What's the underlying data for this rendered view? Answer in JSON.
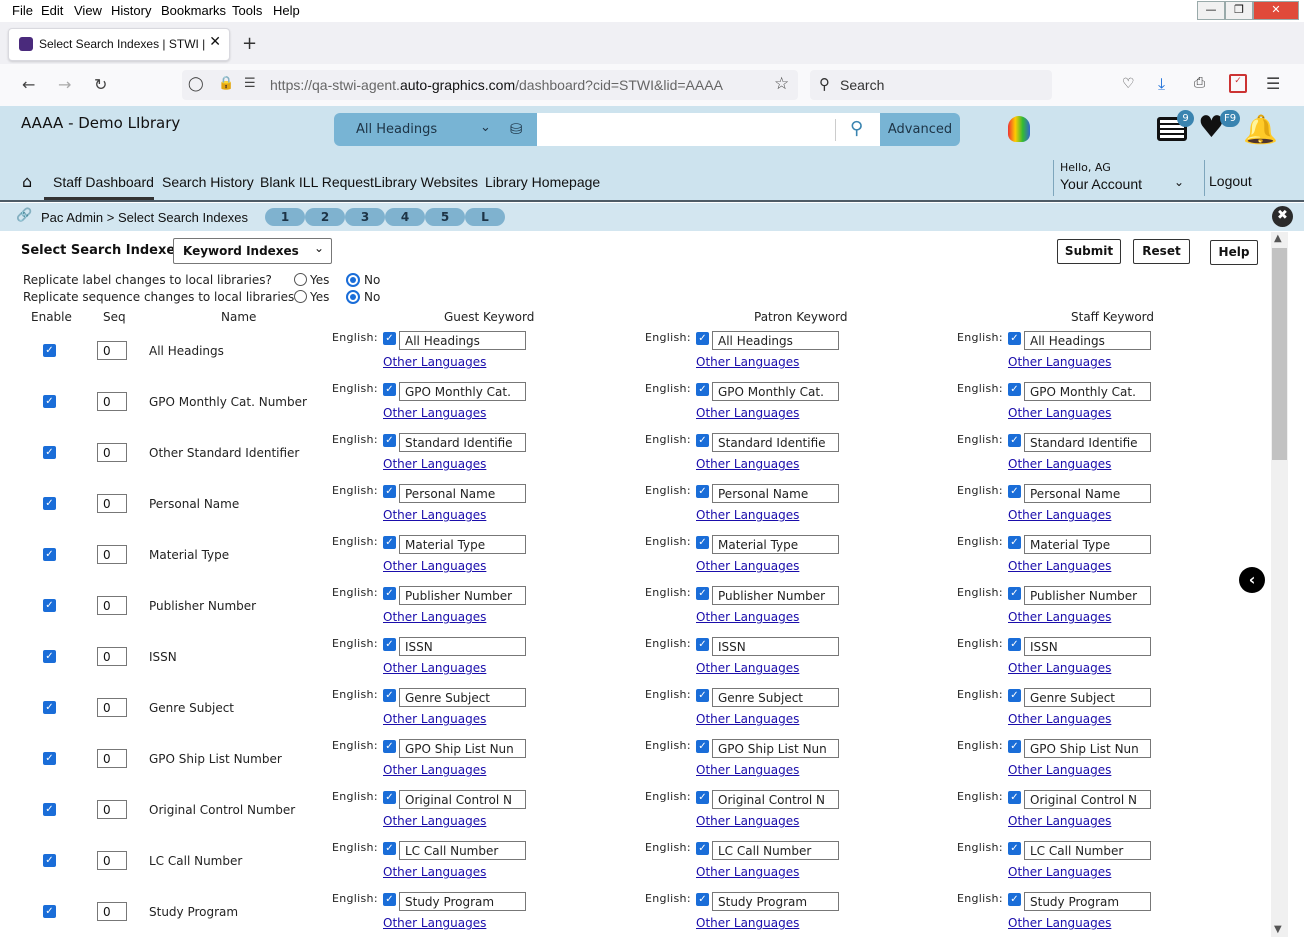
{
  "menubar": [
    "File",
    "Edit",
    "View",
    "History",
    "Bookmarks",
    "Tools",
    "Help"
  ],
  "browser": {
    "tab_title": "Select Search Indexes | STWI | aa",
    "url_prefix": "https://qa-stwi-agent.",
    "url_domain": "auto-graphics.com",
    "url_path": "/dashboard?cid=STWI&lid=AAAA",
    "search_placeholder": "Search"
  },
  "header": {
    "library_name": "AAAA - Demo LIbrary",
    "heading_select": "All Headings",
    "advanced_label": "Advanced",
    "list_badge": "9",
    "fav_badge": "F9"
  },
  "nav": {
    "items": [
      "Staff Dashboard",
      "Search History",
      "Blank ILL Request",
      "Library Websites",
      "Library Homepage"
    ],
    "greeting": "Hello, AG",
    "account": "Your Account",
    "logout": "Logout"
  },
  "breadcrumb": {
    "text": "Pac Admin > Select Search Indexes",
    "pills": [
      "1",
      "2",
      "3",
      "4",
      "5",
      "L"
    ]
  },
  "page": {
    "title": "Select Search Indexes",
    "index_type": "Keyword Indexes",
    "submit": "Submit",
    "reset": "Reset",
    "help": "Help",
    "q1": "Replicate label changes to local libraries?",
    "q2": "Replicate sequence changes to local libraries?",
    "yes": "Yes",
    "no": "No",
    "q1_value": "No",
    "q2_value": "No",
    "col_enable": "Enable",
    "col_seq": "Seq",
    "col_name": "Name",
    "col_guest": "Guest Keyword",
    "col_patron": "Patron Keyword",
    "col_staff": "Staff Keyword",
    "english_label": "English:",
    "other_languages": "Other Languages"
  },
  "rows": [
    {
      "name": "All Headings",
      "seq": "0",
      "label": "All Headings"
    },
    {
      "name": "GPO Monthly Cat. Number",
      "seq": "0",
      "label": "GPO Monthly Cat."
    },
    {
      "name": "Other Standard Identifier",
      "seq": "0",
      "label": "Standard Identifie"
    },
    {
      "name": "Personal Name",
      "seq": "0",
      "label": "Personal Name"
    },
    {
      "name": "Material Type",
      "seq": "0",
      "label": "Material Type"
    },
    {
      "name": "Publisher Number",
      "seq": "0",
      "label": "Publisher Number"
    },
    {
      "name": "ISSN",
      "seq": "0",
      "label": "ISSN"
    },
    {
      "name": "Genre Subject",
      "seq": "0",
      "label": "Genre Subject"
    },
    {
      "name": "GPO Ship List Number",
      "seq": "0",
      "label": "GPO Ship List Nun"
    },
    {
      "name": "Original Control Number",
      "seq": "0",
      "label": "Original Control N"
    },
    {
      "name": "LC Call Number",
      "seq": "0",
      "label": "LC Call Number"
    },
    {
      "name": "Study Program",
      "seq": "0",
      "label": "Study Program"
    }
  ]
}
